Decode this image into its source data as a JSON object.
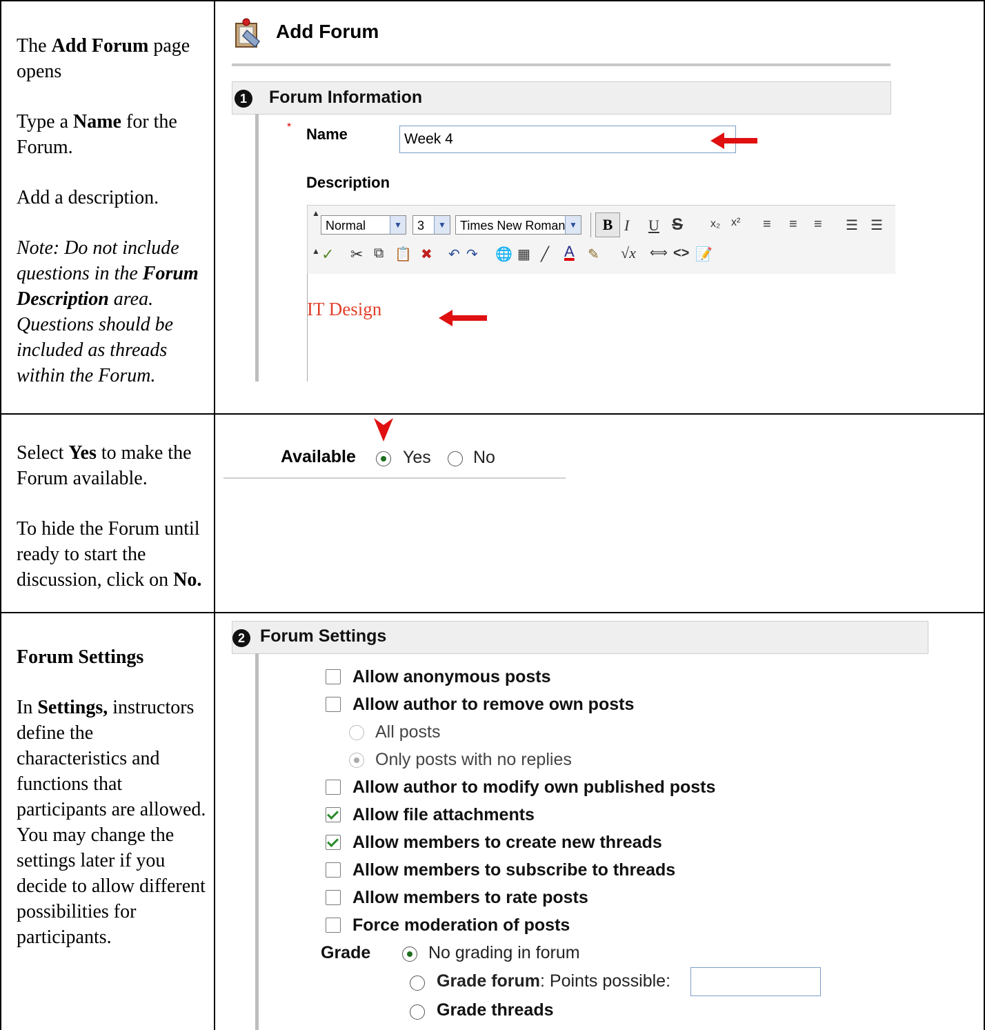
{
  "left_col": {
    "row1": {
      "p1_pre": "The ",
      "p1_bold": "Add Forum",
      "p1_post": " page opens",
      "p2_pre": "Type a ",
      "p2_bold": "Name",
      "p2_post": " for the Forum.",
      "p3": "Add a description.",
      "note_pre": "Note: Do not include questions in the ",
      "note_bold": "Forum Description",
      "note_post": " area. Questions should be included as threads within the Forum."
    },
    "row2": {
      "p1_pre": "Select ",
      "p1_bold": "Yes",
      "p1_post": " to make the Forum available.",
      "p2_pre": "To hide the Forum until ready to start the discussion, click on ",
      "p2_bold": "No."
    },
    "row3": {
      "heading": "Forum Settings",
      "p_pre": "In ",
      "p_bold": "Settings,",
      "p_post": " instructors define the characteristics and functions that participants are allowed.  You may change the settings later if you decide to allow different possibilities for participants."
    }
  },
  "add_forum": {
    "page_title": "Add Forum",
    "section1_number": "1",
    "section1_title": "Forum Information",
    "required_marker": "*",
    "name_label": "Name",
    "name_value": "Week 4",
    "description_label": "Description",
    "editor": {
      "style_select": "Normal",
      "size_select": "3",
      "font_select": "Times New Roman",
      "content": "IT Design"
    }
  },
  "availability": {
    "label": "Available",
    "options": [
      {
        "label": "Yes",
        "selected": true
      },
      {
        "label": "No",
        "selected": false
      }
    ]
  },
  "forum_settings": {
    "section2_number": "2",
    "section2_title": "Forum Settings",
    "checkboxes": [
      {
        "label": "Allow anonymous posts",
        "checked": false
      },
      {
        "label": "Allow author to remove own posts",
        "checked": false
      },
      {
        "label": "Allow author to modify own published posts",
        "checked": false
      },
      {
        "label": "Allow file attachments",
        "checked": true
      },
      {
        "label": "Allow members to create new threads",
        "checked": true
      },
      {
        "label": "Allow members to subscribe to threads",
        "checked": false
      },
      {
        "label": "Allow members to rate posts",
        "checked": false
      },
      {
        "label": "Force moderation of posts",
        "checked": false
      }
    ],
    "remove_suboptions": [
      {
        "label": "All posts",
        "selected": false
      },
      {
        "label": "Only posts with no replies",
        "selected": true
      }
    ],
    "grade_label": "Grade",
    "grade_options": {
      "no_grading": "No grading in forum",
      "grade_forum_bold": "Grade forum",
      "grade_forum_rest": ": Points possible:",
      "grade_threads": "Grade threads"
    },
    "points_possible_value": ""
  },
  "colors": {
    "arrow": "#e01010",
    "editor_text": "#e0402a",
    "check_green": "#2a8a2a"
  }
}
